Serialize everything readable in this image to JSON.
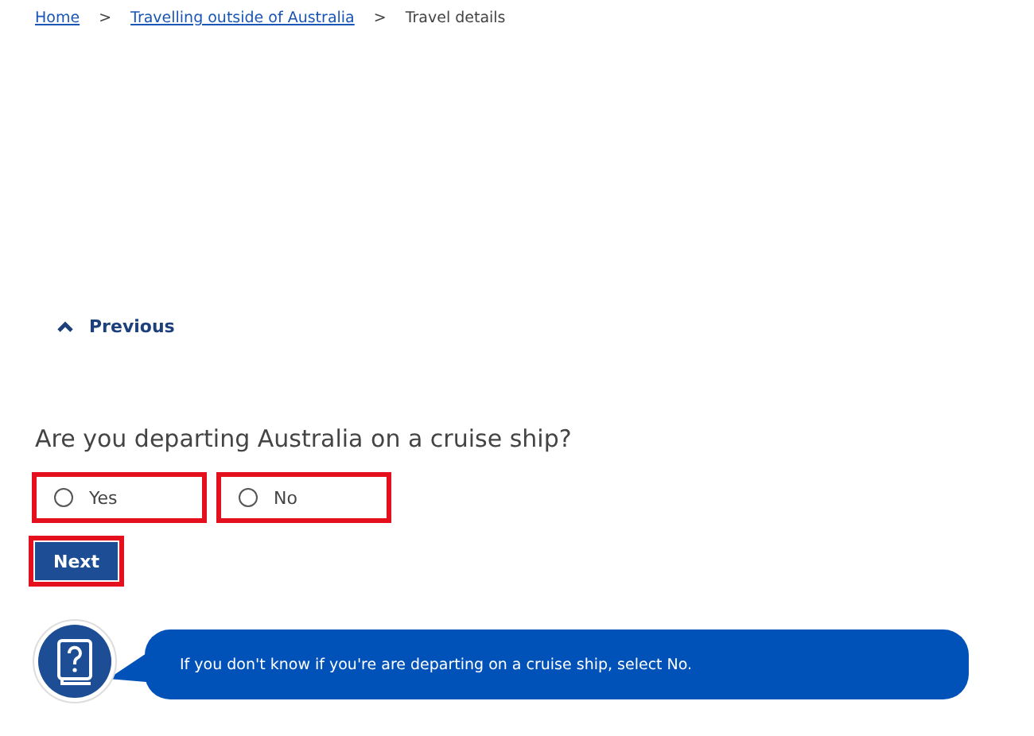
{
  "breadcrumb": [
    {
      "label": "Home",
      "link": true
    },
    {
      "label": "Travelling outside of Australia",
      "link": true
    },
    {
      "label": "Travel details",
      "link": false
    }
  ],
  "breadcrumb_separator": ">",
  "previous": {
    "label": "Previous"
  },
  "question": {
    "text": "Are you departing Australia on a cruise ship?",
    "options": [
      {
        "label": "Yes",
        "selected": false,
        "highlighted": true
      },
      {
        "label": "No",
        "selected": false,
        "highlighted": true
      }
    ]
  },
  "next_button": {
    "label": "Next",
    "highlighted": true
  },
  "help": {
    "text": "If you don't know if you're are departing on a cruise ship, select No."
  }
}
